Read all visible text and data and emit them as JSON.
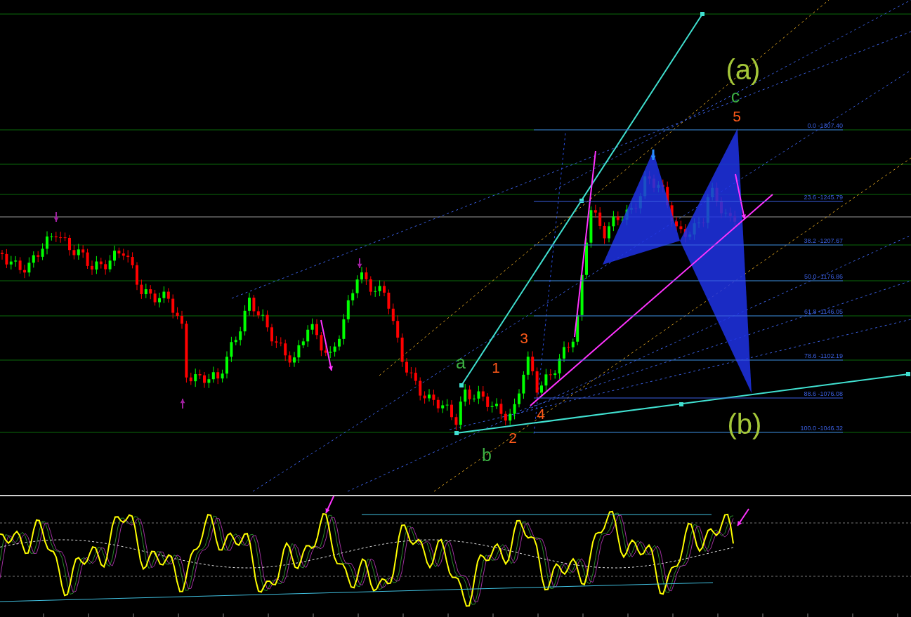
{
  "chart": {
    "fib_levels": [
      {
        "label": "0.0 -1307.40"
      },
      {
        "label": "23.6 -1245.79"
      },
      {
        "label": "38.2 -1207.67"
      },
      {
        "label": "50.0 -1176.86"
      },
      {
        "label": "61.8 -1146.05"
      },
      {
        "label": "78.6 -1102.19"
      },
      {
        "label": "88.6 -1076.08"
      },
      {
        "label": "100.0 -1046.32"
      }
    ],
    "wave_labels": [
      {
        "text": "(a)",
        "color": "#a4c639"
      },
      {
        "text": "c",
        "color": "#3cb043"
      },
      {
        "text": "5",
        "color": "#ff5a1a"
      },
      {
        "text": "3",
        "color": "#ff5a1a"
      },
      {
        "text": "a",
        "color": "#3cb043"
      },
      {
        "text": "1",
        "color": "#ff5a1a"
      },
      {
        "text": "4",
        "color": "#ff5a1a"
      },
      {
        "text": "2",
        "color": "#ff5a1a"
      },
      {
        "text": "(b)",
        "color": "#a4c639"
      },
      {
        "text": "b",
        "color": "#3cb043"
      }
    ]
  }
}
